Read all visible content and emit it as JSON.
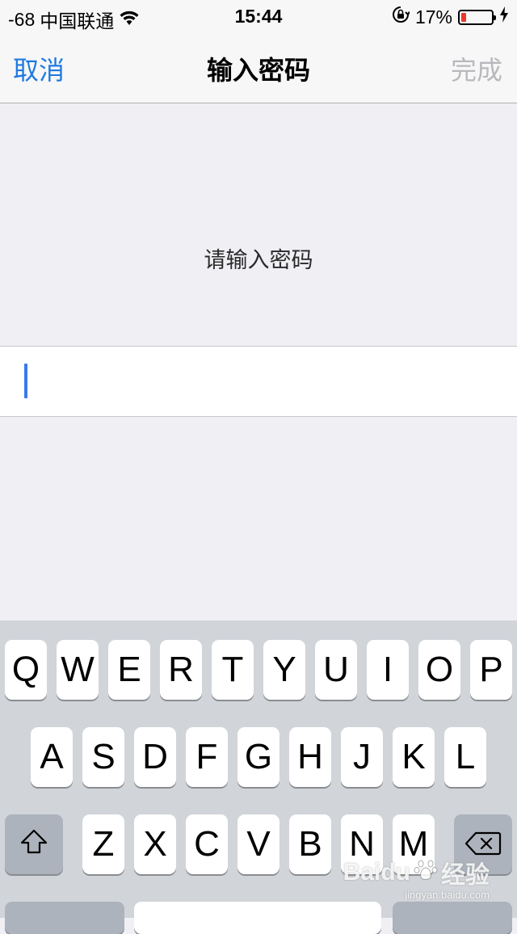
{
  "status_bar": {
    "signal": "-68",
    "carrier": "中国联通",
    "time": "15:44",
    "battery_percent_label": "17%",
    "battery_level": 0.17,
    "battery_color": "#e8372c"
  },
  "nav": {
    "cancel_label": "取消",
    "title": "输入密码",
    "done_label": "完成",
    "accent_color": "#1f7ae0",
    "disabled_color": "#b9b9bd"
  },
  "prompt": {
    "text": "请输入密码"
  },
  "password_field": {
    "value": "",
    "placeholder": ""
  },
  "keyboard": {
    "row1": [
      "Q",
      "W",
      "E",
      "R",
      "T",
      "Y",
      "U",
      "I",
      "O",
      "P"
    ],
    "row2": [
      "A",
      "S",
      "D",
      "F",
      "G",
      "H",
      "J",
      "K",
      "L"
    ],
    "row3": [
      "Z",
      "X",
      "C",
      "V",
      "B",
      "N",
      "M"
    ],
    "shift_icon": "shift-icon",
    "delete_icon": "delete-icon"
  },
  "watermark": {
    "brand": "Baidu",
    "brand_cn": "经验",
    "url": "jingyan.baidu.com"
  }
}
